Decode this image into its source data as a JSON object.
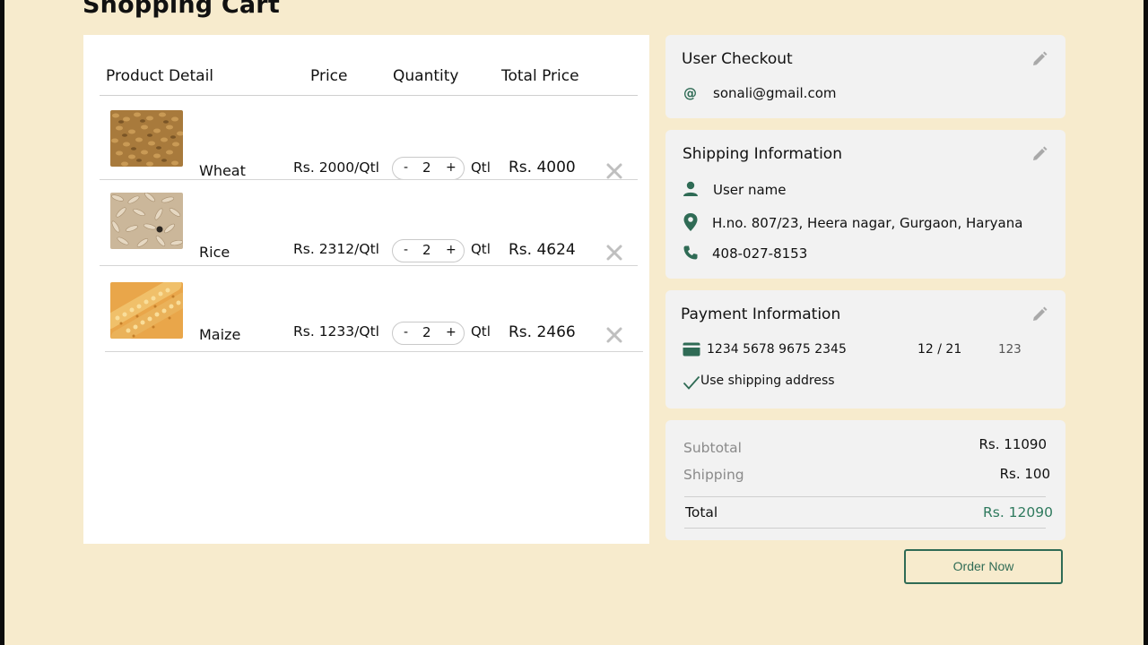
{
  "page": {
    "title": "Shopping Cart"
  },
  "cart": {
    "headers": {
      "product": "Product Detail",
      "price": "Price",
      "quantity": "Quantity",
      "total": "Total Price"
    },
    "items": [
      {
        "name": "Wheat",
        "price": "Rs. 2000/Qtl",
        "qty": "2",
        "unit": "Qtl",
        "total": "Rs. 4000",
        "minus": "-",
        "plus": "+",
        "image": "wheat-grain-image"
      },
      {
        "name": "Rice",
        "price": "Rs. 2312/Qtl",
        "qty": "2",
        "unit": "Qtl",
        "total": "Rs. 4624",
        "minus": "-",
        "plus": "+",
        "image": "rice-grain-image"
      },
      {
        "name": "Maize",
        "price": "Rs. 1233/Qtl",
        "qty": "2",
        "unit": "Qtl",
        "total": "Rs. 2466",
        "minus": "-",
        "plus": "+",
        "image": "maize-corn-image"
      }
    ]
  },
  "checkout": {
    "title": "User Checkout",
    "email": "sonali@gmail.com"
  },
  "shipping": {
    "title": "Shipping Information",
    "name": "User name",
    "address": "H.no. 807/23, Heera nagar, Gurgaon, Haryana",
    "phone": "408-027-8153"
  },
  "payment": {
    "title": "Payment Information",
    "card_number": "1234 5678 9675 2345",
    "expiry": "12 / 21",
    "cvv": "123",
    "use_shipping": "Use shipping address"
  },
  "summary": {
    "subtotal_label": "Subtotal",
    "subtotal": "Rs. 11090",
    "shipping_label": "Shipping",
    "shipping": "Rs. 100",
    "total_label": "Total",
    "total": "Rs. 12090"
  },
  "actions": {
    "order_now": "Order Now"
  },
  "colors": {
    "background": "#f7ebcd",
    "accent": "#2f6b55",
    "card": "#f2f2f2",
    "total_value": "#2f7a5e"
  }
}
